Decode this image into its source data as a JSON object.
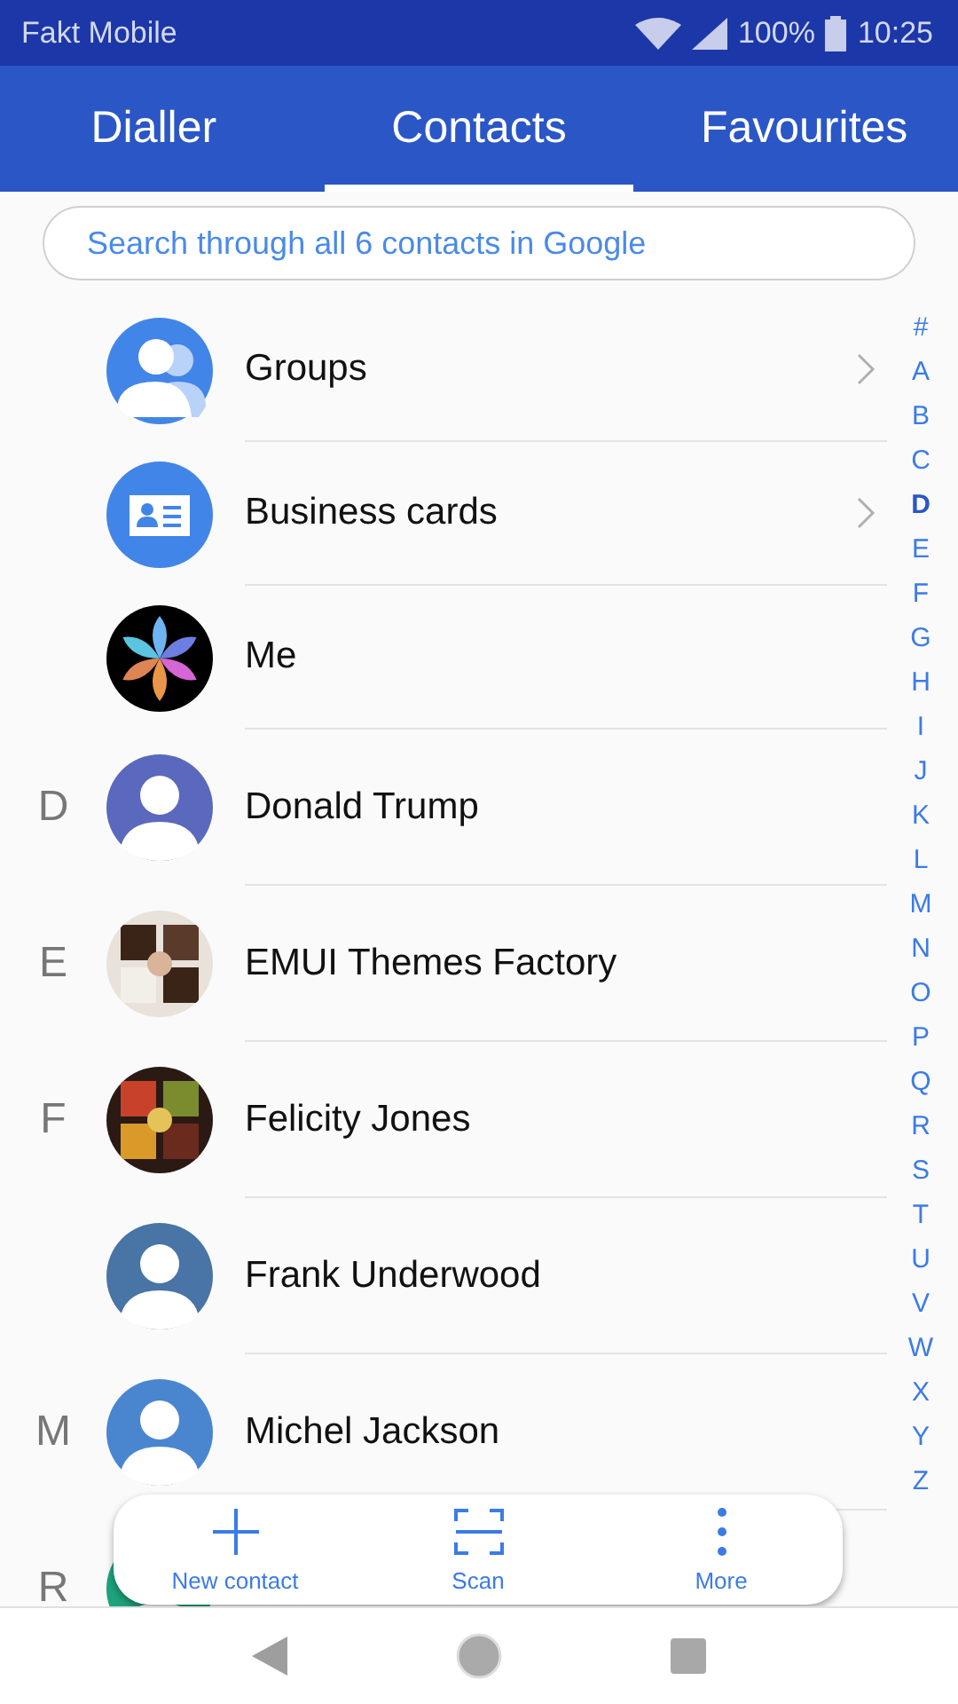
{
  "status_bar": {
    "carrier": "Fakt Mobile",
    "battery": "100%",
    "time": "10:25"
  },
  "tabs": [
    {
      "label": "Dialler",
      "selected": false
    },
    {
      "label": "Contacts",
      "selected": true
    },
    {
      "label": "Favourites",
      "selected": false
    }
  ],
  "search": {
    "placeholder": "Search through all 6 contacts in Google"
  },
  "rows": [
    {
      "kind": "groups",
      "name": "Groups",
      "chevron": true
    },
    {
      "kind": "card",
      "name": "Business cards",
      "chevron": true
    },
    {
      "kind": "flower",
      "name": "Me",
      "chevron": false
    },
    {
      "kind": "person",
      "section": "D",
      "name": "Donald Trump",
      "color": "#5a69bd"
    },
    {
      "kind": "picture",
      "section": "E",
      "name": "EMUI Themes Factory"
    },
    {
      "kind": "picture",
      "section": "F",
      "name": "Felicity Jones"
    },
    {
      "kind": "person",
      "name": "Frank Underwood",
      "color": "#4874a6"
    },
    {
      "kind": "person",
      "section": "M",
      "name": "Michel Jackson",
      "color": "#4a86d0"
    },
    {
      "kind": "person",
      "section": "R",
      "color": "#1ea37c"
    }
  ],
  "index": [
    {
      "label": "#",
      "selected": false
    },
    {
      "label": "A",
      "selected": false
    },
    {
      "label": "B",
      "selected": false
    },
    {
      "label": "C",
      "selected": false
    },
    {
      "label": "D",
      "selected": true
    },
    {
      "label": "E",
      "selected": false
    },
    {
      "label": "F",
      "selected": false
    },
    {
      "label": "G",
      "selected": false
    },
    {
      "label": "H",
      "selected": false
    },
    {
      "label": "I",
      "selected": false
    },
    {
      "label": "J",
      "selected": false
    },
    {
      "label": "K",
      "selected": false
    },
    {
      "label": "L",
      "selected": false
    },
    {
      "label": "M",
      "selected": false
    },
    {
      "label": "N",
      "selected": false
    },
    {
      "label": "O",
      "selected": false
    },
    {
      "label": "P",
      "selected": false
    },
    {
      "label": "Q",
      "selected": false
    },
    {
      "label": "R",
      "selected": false
    },
    {
      "label": "S",
      "selected": false
    },
    {
      "label": "T",
      "selected": false
    },
    {
      "label": "U",
      "selected": false
    },
    {
      "label": "V",
      "selected": false
    },
    {
      "label": "W",
      "selected": false
    },
    {
      "label": "X",
      "selected": false
    },
    {
      "label": "Y",
      "selected": false
    },
    {
      "label": "Z",
      "selected": false
    }
  ],
  "toolbar": [
    {
      "kind": "add",
      "label": "New contact"
    },
    {
      "kind": "scan",
      "label": "Scan"
    },
    {
      "kind": "more",
      "label": "More"
    }
  ]
}
